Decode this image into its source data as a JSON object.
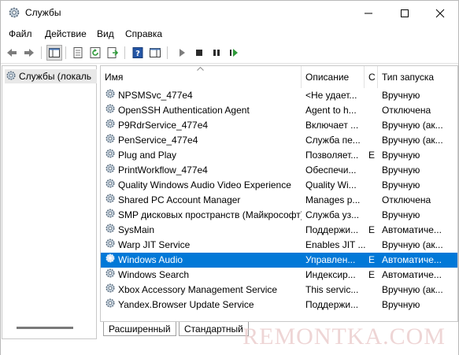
{
  "window": {
    "title": "Службы"
  },
  "menu": [
    "Файл",
    "Действие",
    "Вид",
    "Справка"
  ],
  "left_tree": {
    "item": "Службы (локаль"
  },
  "columns": {
    "name": "Имя",
    "description": "Описание",
    "state": "С",
    "startup": "Тип запуска"
  },
  "rows": [
    {
      "name": "NPSMSvc_477e4",
      "description": "<Не удает...",
      "state": "",
      "startup": "Вручную"
    },
    {
      "name": "OpenSSH Authentication Agent",
      "description": "Agent to h...",
      "state": "",
      "startup": "Отключена"
    },
    {
      "name": "P9RdrService_477e4",
      "description": "Включает ...",
      "state": "",
      "startup": "Вручную (ак..."
    },
    {
      "name": "PenService_477e4",
      "description": "Служба пе...",
      "state": "",
      "startup": "Вручную (ак..."
    },
    {
      "name": "Plug and Play",
      "description": "Позволяет...",
      "state": "Е",
      "startup": "Вручную"
    },
    {
      "name": "PrintWorkflow_477e4",
      "description": "Обеспечи...",
      "state": "",
      "startup": "Вручную"
    },
    {
      "name": "Quality Windows Audio Video Experience",
      "description": "Quality Wi...",
      "state": "",
      "startup": "Вручную"
    },
    {
      "name": "Shared PC Account Manager",
      "description": "Manages p...",
      "state": "",
      "startup": "Отключена"
    },
    {
      "name": "SMP дисковых пространств (Майкрософт)",
      "description": "Служба уз...",
      "state": "",
      "startup": "Вручную"
    },
    {
      "name": "SysMain",
      "description": "Поддержи...",
      "state": "Е",
      "startup": "Автоматиче..."
    },
    {
      "name": "Warp JIT Service",
      "description": "Enables JIT ...",
      "state": "",
      "startup": "Вручную (ак..."
    },
    {
      "name": "Windows Audio",
      "description": "Управлен...",
      "state": "Е",
      "startup": "Автоматиче...",
      "selected": true
    },
    {
      "name": "Windows Search",
      "description": "Индексир...",
      "state": "Е",
      "startup": "Автоматиче..."
    },
    {
      "name": "Xbox Accessory Management Service",
      "description": "This servic...",
      "state": "",
      "startup": "Вручную (ак..."
    },
    {
      "name": "Yandex.Browser Update Service",
      "description": "Поддержи...",
      "state": "",
      "startup": "Вручную"
    }
  ],
  "tabs": [
    "Расширенный",
    "Стандартный"
  ],
  "watermark": "REMONTKA.COM",
  "colors": {
    "selection": "#0078d7",
    "gear": "#6b7b8c",
    "play": "#2f9a3a"
  }
}
